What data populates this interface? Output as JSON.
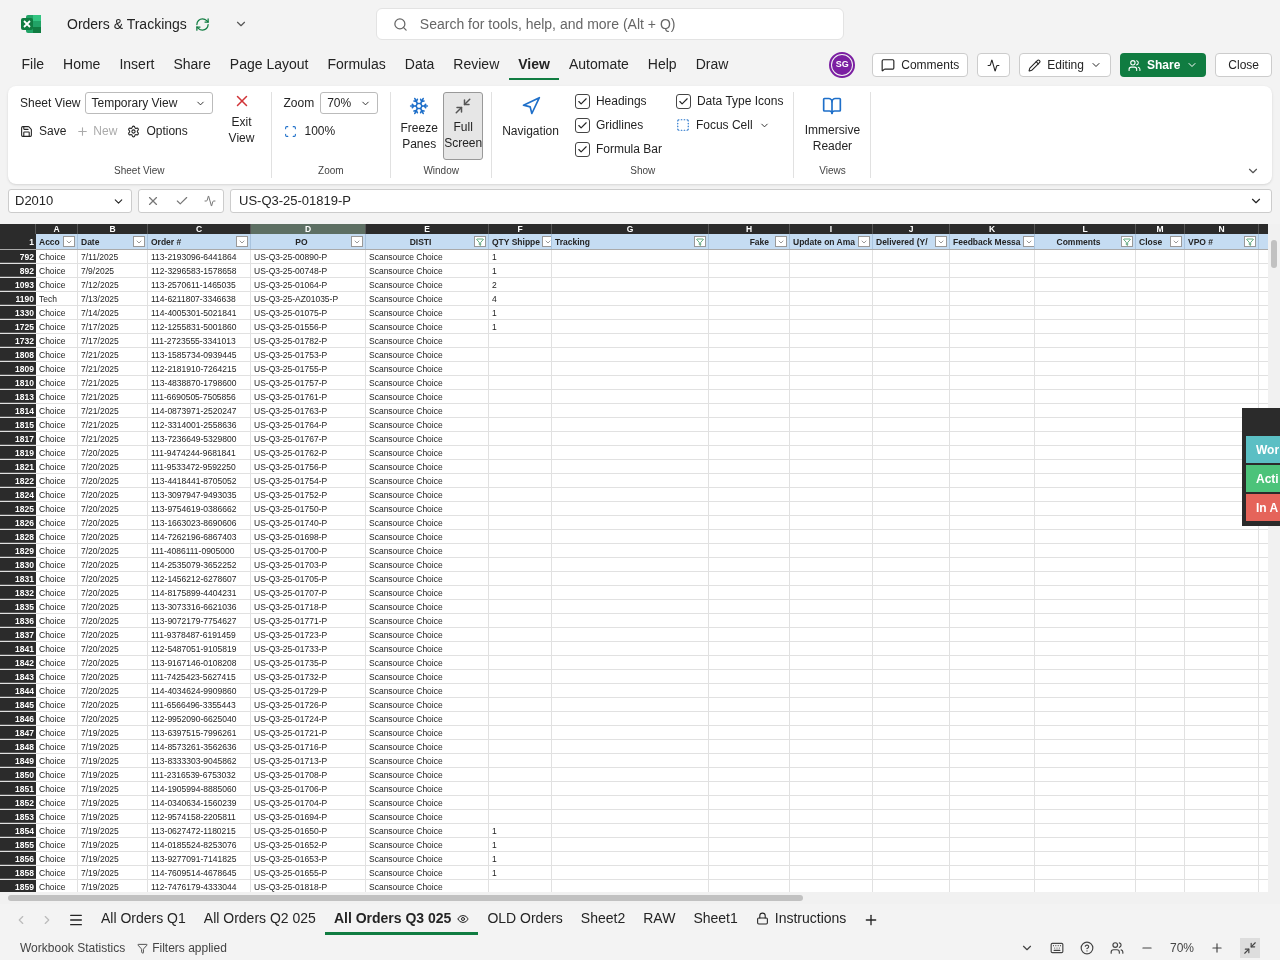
{
  "title_bar": {
    "title": "Orders & Trackings",
    "search": {
      "placeholder": "Search for tools, help, and more (Alt + Q)"
    }
  },
  "menu": [
    {
      "label": "File",
      "selected": false
    },
    {
      "label": "Home",
      "selected": false
    },
    {
      "label": "Insert",
      "selected": false
    },
    {
      "label": "Share",
      "selected": false
    },
    {
      "label": "Page Layout",
      "selected": false
    },
    {
      "label": "Formulas",
      "selected": false
    },
    {
      "label": "Data",
      "selected": false
    },
    {
      "label": "Review",
      "selected": false
    },
    {
      "label": "View",
      "selected": true
    },
    {
      "label": "Automate",
      "selected": false
    },
    {
      "label": "Help",
      "selected": false
    },
    {
      "label": "Draw",
      "selected": false
    }
  ],
  "account": {
    "initials": "SG"
  },
  "actions": {
    "comments": "Comments",
    "editing": "Editing",
    "share": "Share",
    "close": "Close"
  },
  "ribbon": {
    "sheet_view": {
      "label": "Sheet View",
      "view": "Temporary View",
      "save": "Save",
      "new": {
        "label": "New",
        "disabled": true
      },
      "options": "Options",
      "exit": "Exit View",
      "group": "Sheet View"
    },
    "zoom": {
      "label": "Zoom",
      "value": "70%",
      "reset": "100%",
      "group": "Zoom"
    },
    "window": {
      "freeze": "Freeze Panes",
      "full_screen": {
        "label": "Full Screen",
        "selected": true
      },
      "group": "Window"
    },
    "navigation": "Navigation",
    "show": {
      "options": [
        {
          "label": "Headings",
          "checked": true
        },
        {
          "label": "Gridlines",
          "checked": true
        },
        {
          "label": "Formula Bar",
          "checked": true
        },
        {
          "label": "Data Type Icons",
          "checked": true
        }
      ],
      "focus_cell": "Focus Cell",
      "group": "Show"
    },
    "views": {
      "reader": "Immersive Reader",
      "group": "Views"
    }
  },
  "formula_bar": {
    "name_box": "D2010",
    "formula": "US-Q3-25-01819-P"
  },
  "sheet": {
    "header_row_number": "1",
    "columns": [
      {
        "letter": "A",
        "header": "Acco",
        "filtered": false,
        "selected": false
      },
      {
        "letter": "B",
        "header": "Date",
        "filtered": false,
        "selected": false
      },
      {
        "letter": "C",
        "header": "Order #",
        "filtered": false,
        "selected": false
      },
      {
        "letter": "D",
        "header": "PO",
        "filtered": false,
        "selected": true
      },
      {
        "letter": "E",
        "header": "DISTI",
        "filtered": true,
        "selected": false
      },
      {
        "letter": "F",
        "header": "QTY Shippe",
        "filtered": false,
        "selected": false
      },
      {
        "letter": "G",
        "header": "Tracking",
        "filtered": true,
        "selected": false
      },
      {
        "letter": "H",
        "header": "Fake",
        "filtered": false,
        "selected": false
      },
      {
        "letter": "I",
        "header": "Update on Ama",
        "filtered": false,
        "selected": false
      },
      {
        "letter": "J",
        "header": "Delivered (Y/",
        "filtered": false,
        "selected": false
      },
      {
        "letter": "K",
        "header": "Feedback Messa",
        "filtered": false,
        "selected": false
      },
      {
        "letter": "L",
        "header": "Comments",
        "filtered": true,
        "selected": false
      },
      {
        "letter": "M",
        "header": "Close",
        "filtered": false,
        "selected": false
      },
      {
        "letter": "N",
        "header": "VPO #",
        "filtered": true,
        "selected": false
      }
    ],
    "rows": [
      {
        "n": "792",
        "cells": [
          "Choice",
          "7/11/2025",
          "113-2193096-6441864",
          "US-Q3-25-00890-P",
          "Scansource Choice",
          "1"
        ]
      },
      {
        "n": "892",
        "cells": [
          "Choice",
          "7/9/2025",
          "112-3296583-1578658",
          "US-Q3-25-00748-P",
          "Scansource Choice",
          "1"
        ]
      },
      {
        "n": "1093",
        "cells": [
          "Choice",
          "7/12/2025",
          "113-2570611-1465035",
          "US-Q3-25-01064-P",
          "Scansource Choice",
          "2"
        ]
      },
      {
        "n": "1190",
        "cells": [
          "Tech",
          "7/13/2025",
          "114-6211807-3346638",
          "US-Q3-25-AZ01035-P",
          "Scansource Choice",
          "4"
        ]
      },
      {
        "n": "1330",
        "cells": [
          "Choice",
          "7/14/2025",
          "114-4005301-5021841",
          "US-Q3-25-01075-P",
          "Scansource Choice",
          "1"
        ]
      },
      {
        "n": "1725",
        "cells": [
          "Choice",
          "7/17/2025",
          "112-1255831-5001860",
          "US-Q3-25-01556-P",
          "Scansource Choice",
          "1"
        ]
      },
      {
        "n": "1732",
        "cells": [
          "Choice",
          "7/17/2025",
          "111-2723555-3341013",
          "US-Q3-25-01782-P",
          "Scansource Choice"
        ]
      },
      {
        "n": "1808",
        "cells": [
          "Choice",
          "7/21/2025",
          "113-1585734-0939445",
          "US-Q3-25-01753-P",
          "Scansource Choice"
        ]
      },
      {
        "n": "1809",
        "cells": [
          "Choice",
          "7/21/2025",
          "112-2181910-7264215",
          "US-Q3-25-01755-P",
          "Scansource Choice"
        ]
      },
      {
        "n": "1810",
        "cells": [
          "Choice",
          "7/21/2025",
          "113-4838870-1798600",
          "US-Q3-25-01757-P",
          "Scansource Choice"
        ]
      },
      {
        "n": "1813",
        "cells": [
          "Choice",
          "7/21/2025",
          "111-6690505-7505856",
          "US-Q3-25-01761-P",
          "Scansource Choice"
        ]
      },
      {
        "n": "1814",
        "cells": [
          "Choice",
          "7/21/2025",
          "114-0873971-2520247",
          "US-Q3-25-01763-P",
          "Scansource Choice"
        ]
      },
      {
        "n": "1815",
        "cells": [
          "Choice",
          "7/21/2025",
          "112-3314001-2558636",
          "US-Q3-25-01764-P",
          "Scansource Choice"
        ]
      },
      {
        "n": "1817",
        "cells": [
          "Choice",
          "7/21/2025",
          "113-7236649-5329800",
          "US-Q3-25-01767-P",
          "Scansource Choice"
        ]
      },
      {
        "n": "1819",
        "cells": [
          "Choice",
          "7/20/2025",
          "111-9474244-9681841",
          "US-Q3-25-01762-P",
          "Scansource Choice"
        ]
      },
      {
        "n": "1821",
        "cells": [
          "Choice",
          "7/20/2025",
          "111-9533472-9592250",
          "US-Q3-25-01756-P",
          "Scansource Choice"
        ]
      },
      {
        "n": "1822",
        "cells": [
          "Choice",
          "7/20/2025",
          "113-4418441-8705052",
          "US-Q3-25-01754-P",
          "Scansource Choice"
        ]
      },
      {
        "n": "1824",
        "cells": [
          "Choice",
          "7/20/2025",
          "113-3097947-9493035",
          "US-Q3-25-01752-P",
          "Scansource Choice"
        ]
      },
      {
        "n": "1825",
        "cells": [
          "Choice",
          "7/20/2025",
          "113-9754619-0386662",
          "US-Q3-25-01750-P",
          "Scansource Choice"
        ]
      },
      {
        "n": "1826",
        "cells": [
          "Choice",
          "7/20/2025",
          "113-1663023-8690606",
          "US-Q3-25-01740-P",
          "Scansource Choice"
        ]
      },
      {
        "n": "1828",
        "cells": [
          "Choice",
          "7/20/2025",
          "114-7262196-6867403",
          "US-Q3-25-01698-P",
          "Scansource Choice"
        ]
      },
      {
        "n": "1829",
        "cells": [
          "Choice",
          "7/20/2025",
          "111-4086111-0905000",
          "US-Q3-25-01700-P",
          "Scansource Choice"
        ]
      },
      {
        "n": "1830",
        "cells": [
          "Choice",
          "7/20/2025",
          "114-2535079-3652252",
          "US-Q3-25-01703-P",
          "Scansource Choice"
        ]
      },
      {
        "n": "1831",
        "cells": [
          "Choice",
          "7/20/2025",
          "112-1456212-6278607",
          "US-Q3-25-01705-P",
          "Scansource Choice"
        ]
      },
      {
        "n": "1832",
        "cells": [
          "Choice",
          "7/20/2025",
          "114-8175899-4404231",
          "US-Q3-25-01707-P",
          "Scansource Choice"
        ]
      },
      {
        "n": "1835",
        "cells": [
          "Choice",
          "7/20/2025",
          "113-3073316-6621036",
          "US-Q3-25-01718-P",
          "Scansource Choice"
        ]
      },
      {
        "n": "1836",
        "cells": [
          "Choice",
          "7/20/2025",
          "113-9072179-7754627",
          "US-Q3-25-01771-P",
          "Scansource Choice"
        ]
      },
      {
        "n": "1837",
        "cells": [
          "Choice",
          "7/20/2025",
          "111-9378487-6191459",
          "US-Q3-25-01723-P",
          "Scansource Choice"
        ]
      },
      {
        "n": "1841",
        "cells": [
          "Choice",
          "7/20/2025",
          "112-5487051-9105819",
          "US-Q3-25-01733-P",
          "Scansource Choice"
        ]
      },
      {
        "n": "1842",
        "cells": [
          "Choice",
          "7/20/2025",
          "113-9167146-0108208",
          "US-Q3-25-01735-P",
          "Scansource Choice"
        ]
      },
      {
        "n": "1843",
        "cells": [
          "Choice",
          "7/20/2025",
          "111-7425423-5627415",
          "US-Q3-25-01732-P",
          "Scansource Choice"
        ]
      },
      {
        "n": "1844",
        "cells": [
          "Choice",
          "7/20/2025",
          "114-4034624-9909860",
          "US-Q3-25-01729-P",
          "Scansource Choice"
        ]
      },
      {
        "n": "1845",
        "cells": [
          "Choice",
          "7/20/2025",
          "111-6566496-3355443",
          "US-Q3-25-01726-P",
          "Scansource Choice"
        ]
      },
      {
        "n": "1846",
        "cells": [
          "Choice",
          "7/20/2025",
          "112-9952090-6625040",
          "US-Q3-25-01724-P",
          "Scansource Choice"
        ]
      },
      {
        "n": "1847",
        "cells": [
          "Choice",
          "7/19/2025",
          "113-6397515-7996261",
          "US-Q3-25-01721-P",
          "Scansource Choice"
        ]
      },
      {
        "n": "1848",
        "cells": [
          "Choice",
          "7/19/2025",
          "114-8573261-3562636",
          "US-Q3-25-01716-P",
          "Scansource Choice"
        ]
      },
      {
        "n": "1849",
        "cells": [
          "Choice",
          "7/19/2025",
          "113-8333303-9045862",
          "US-Q3-25-01713-P",
          "Scansource Choice"
        ]
      },
      {
        "n": "1850",
        "cells": [
          "Choice",
          "7/19/2025",
          "111-2316539-6753032",
          "US-Q3-25-01708-P",
          "Scansource Choice"
        ]
      },
      {
        "n": "1851",
        "cells": [
          "Choice",
          "7/19/2025",
          "114-1905994-8885060",
          "US-Q3-25-01706-P",
          "Scansource Choice"
        ]
      },
      {
        "n": "1852",
        "cells": [
          "Choice",
          "7/19/2025",
          "114-0340634-1560239",
          "US-Q3-25-01704-P",
          "Scansource Choice"
        ]
      },
      {
        "n": "1853",
        "cells": [
          "Choice",
          "7/19/2025",
          "112-9574158-2205811",
          "US-Q3-25-01694-P",
          "Scansource Choice"
        ]
      },
      {
        "n": "1854",
        "cells": [
          "Choice",
          "7/19/2025",
          "113-0627472-1180215",
          "US-Q3-25-01650-P",
          "Scansource Choice",
          "1"
        ]
      },
      {
        "n": "1855",
        "cells": [
          "Choice",
          "7/19/2025",
          "114-0185524-8253076",
          "US-Q3-25-01652-P",
          "Scansource Choice",
          "1"
        ]
      },
      {
        "n": "1856",
        "cells": [
          "Choice",
          "7/19/2025",
          "113-9277091-7141825",
          "US-Q3-25-01653-P",
          "Scansource Choice",
          "1"
        ]
      },
      {
        "n": "1858",
        "cells": [
          "Choice",
          "7/19/2025",
          "114-7609514-4678645",
          "US-Q3-25-01655-P",
          "Scansource Choice",
          "1"
        ]
      },
      {
        "n": "1859",
        "cells": [
          "Choice",
          "7/19/2025",
          "112-7476179-4333044",
          "US-Q3-25-01818-P",
          "Scansource Choice"
        ]
      }
    ]
  },
  "floating_panel": {
    "buttons": [
      {
        "label": "Wor",
        "color": "#5bbfc4"
      },
      {
        "label": "Acti",
        "color": "#4cc37a"
      },
      {
        "label": "In A",
        "color": "#e5645a"
      }
    ]
  },
  "sheet_tabs": [
    {
      "label": "All Orders Q1",
      "selected": false,
      "kind": "plain"
    },
    {
      "label": "All Orders Q2 025",
      "selected": false,
      "kind": "plain"
    },
    {
      "label": "All Orders Q3 025",
      "selected": true,
      "kind": "watched"
    },
    {
      "label": "OLD Orders",
      "selected": false,
      "kind": "plain"
    },
    {
      "label": "Sheet2",
      "selected": false,
      "kind": "plain"
    },
    {
      "label": "RAW",
      "selected": false,
      "kind": "plain"
    },
    {
      "label": "Sheet1",
      "selected": false,
      "kind": "plain"
    },
    {
      "label": "Instructions",
      "selected": false,
      "kind": "locked"
    }
  ],
  "status_bar": {
    "stats": "Workbook Statistics",
    "filters": "Filters applied",
    "zoom": "70%"
  }
}
